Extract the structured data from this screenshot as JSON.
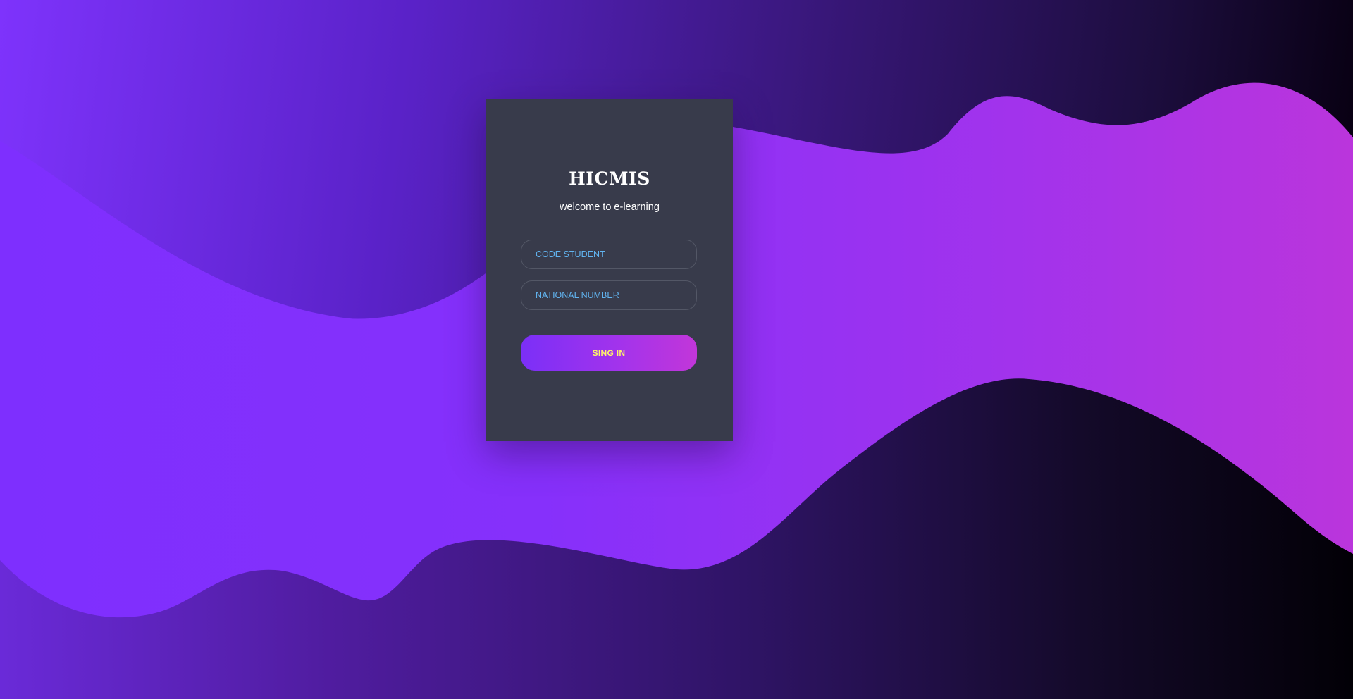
{
  "login": {
    "title": "HICMIS",
    "subtitle": "welcome to e-learning",
    "code_student_placeholder": "CODE STUDENT",
    "national_number_placeholder": "NATIONAL NUMBER",
    "signin_label": "SING IN"
  },
  "colors": {
    "card_background": "#383b4b",
    "placeholder_text": "#61b4f0",
    "button_text": "#fff36a",
    "button_gradient_start": "#7b2ff7",
    "button_gradient_end": "#c236d9",
    "background_purple": "#7f30fe",
    "background_magenta": "#b535e0",
    "background_dark": "#050009"
  }
}
